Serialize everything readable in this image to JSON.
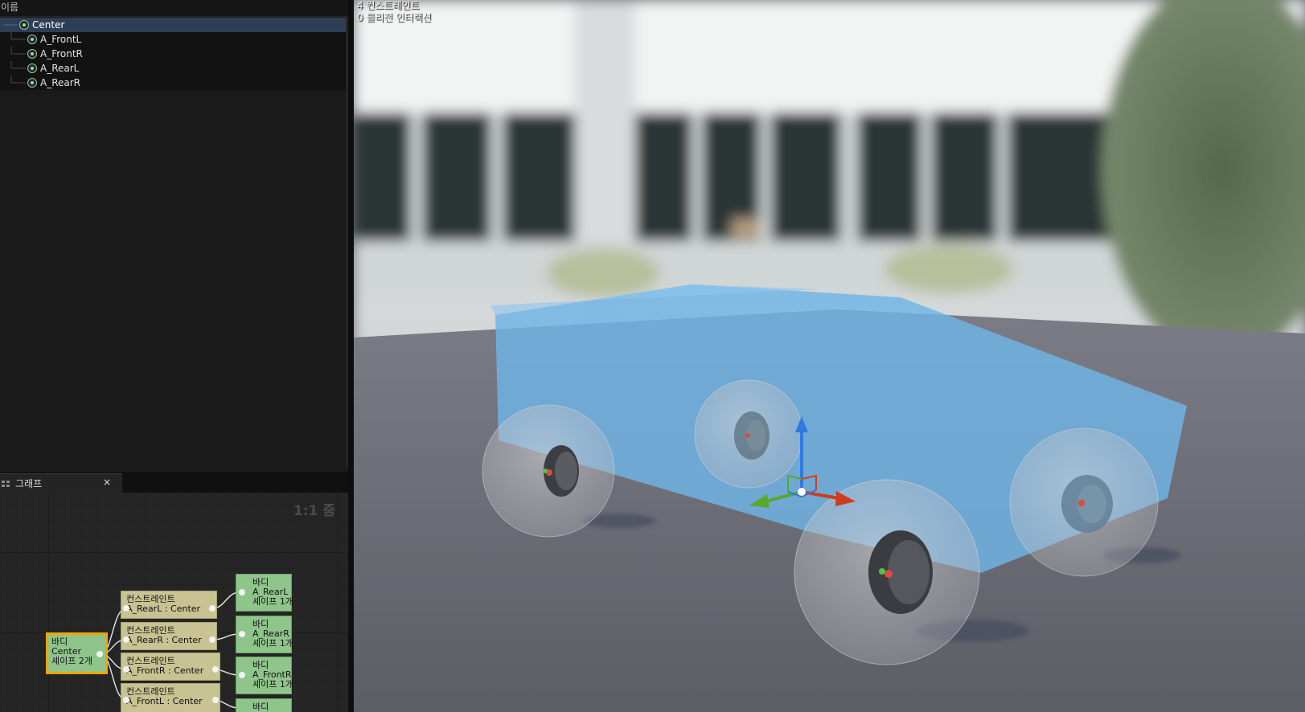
{
  "tree": {
    "header": "이름",
    "items": [
      {
        "label": "Center",
        "selected": true
      },
      {
        "label": "A_FrontL",
        "selected": false
      },
      {
        "label": "A_FrontR",
        "selected": false
      },
      {
        "label": "A_RearL",
        "selected": false
      },
      {
        "label": "A_RearR",
        "selected": false
      }
    ]
  },
  "graph": {
    "tab_label": "그래프",
    "close_label": "×",
    "zoom_label": "1:1 줌",
    "root_node": {
      "lines": [
        "바디",
        "Center",
        "셰이프 2개"
      ]
    },
    "constraint_nodes": [
      {
        "lines": [
          "컨스트레인트",
          "A_RearL : Center"
        ]
      },
      {
        "lines": [
          "컨스트레인트",
          "A_RearR : Center"
        ]
      },
      {
        "lines": [
          "컨스트레인트",
          "A_FrontR : Center"
        ]
      },
      {
        "lines": [
          "컨스트레인트",
          "A_FrontL : Center"
        ]
      }
    ],
    "body_nodes": [
      {
        "lines": [
          "바디",
          "A_RearL",
          "셰이프 1개"
        ]
      },
      {
        "lines": [
          "바디",
          "A_RearR",
          "셰이프 1개"
        ]
      },
      {
        "lines": [
          "바디",
          "A_FrontR",
          "셰이프 1개"
        ]
      },
      {
        "lines": [
          "바디"
        ]
      }
    ]
  },
  "viewport": {
    "stats": [
      "4 컨스트레인트",
      "0 콜리전 인터랙션"
    ]
  },
  "colors": {
    "selection": "#2d3e55",
    "body_node": "#8fc48b",
    "constraint_node": "#c9c292",
    "selected_outline": "#f3a500",
    "physics_body": "#6fb4e6",
    "gizmo_x": "#d23c1e",
    "gizmo_y": "#5aa82a",
    "gizmo_z": "#2d7be0"
  }
}
